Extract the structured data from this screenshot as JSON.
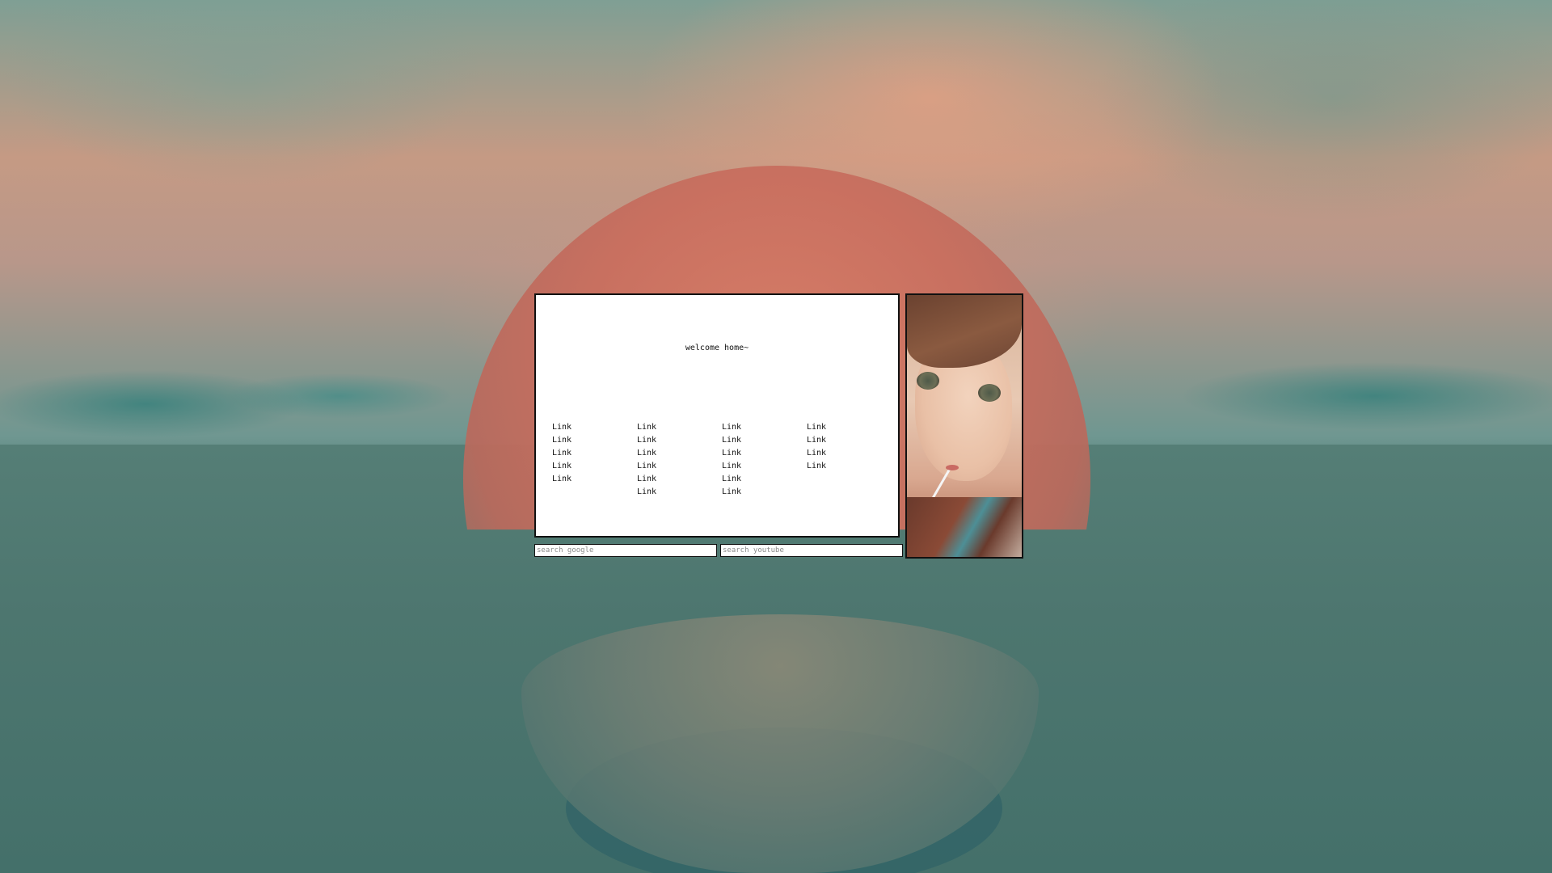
{
  "main": {
    "welcome_text": "welcome home~",
    "link_columns": [
      [
        "Link",
        "Link",
        "Link",
        "Link",
        "Link"
      ],
      [
        "Link",
        "Link",
        "Link",
        "Link",
        "Link",
        "Link"
      ],
      [
        "Link",
        "Link",
        "Link",
        "Link",
        "Link",
        "Link"
      ],
      [
        "Link",
        "Link",
        "Link",
        "Link"
      ]
    ]
  },
  "search": {
    "google_placeholder": "search google",
    "youtube_placeholder": "search youtube"
  },
  "image": {
    "subject": "anime-girl-portrait"
  }
}
